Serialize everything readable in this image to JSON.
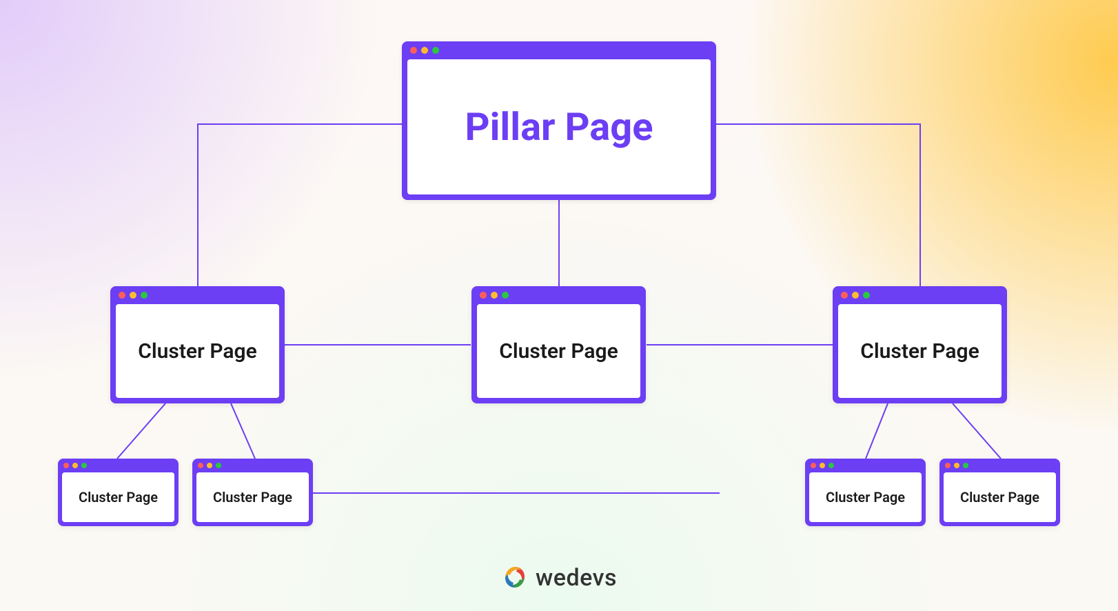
{
  "pillar": {
    "label": "Pillar Page"
  },
  "clusters_mid": [
    {
      "label": "Cluster Page"
    },
    {
      "label": "Cluster Page"
    },
    {
      "label": "Cluster Page"
    }
  ],
  "clusters_small": [
    {
      "label": "Cluster Page"
    },
    {
      "label": "Cluster Page"
    },
    {
      "label": "Cluster Page"
    },
    {
      "label": "Cluster Page"
    }
  ],
  "brand": {
    "name": "wedevs"
  },
  "colors": {
    "primary": "#6c3ef4",
    "dot_red": "#ff5f57",
    "dot_yellow": "#febc2e",
    "dot_green": "#28c840"
  }
}
